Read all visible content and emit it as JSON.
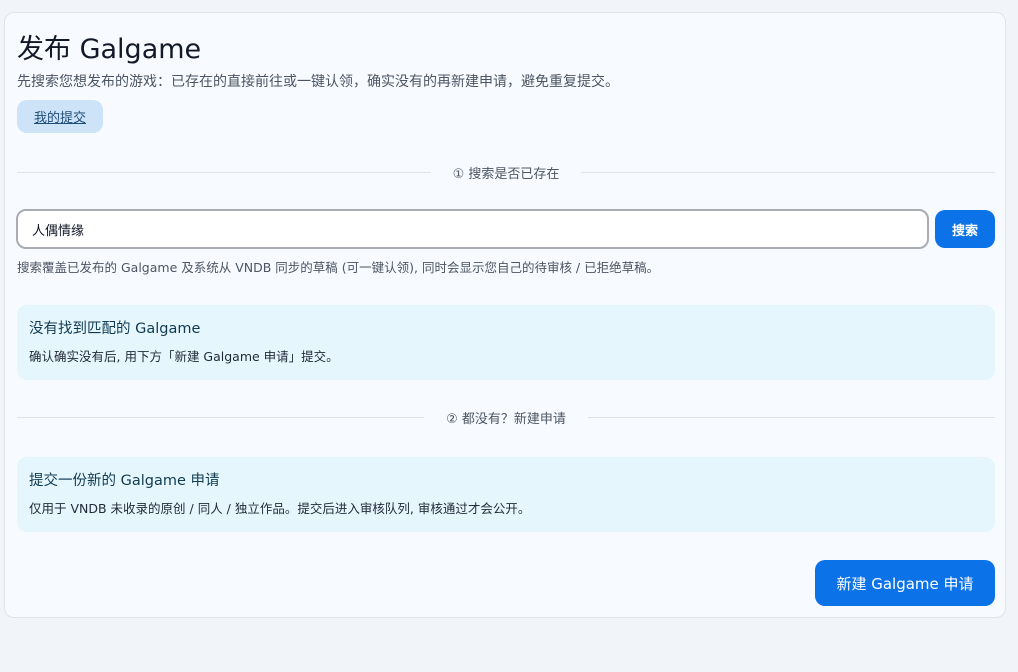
{
  "page": {
    "title": "发布 Galgame",
    "subtitle": "先搜索您想发布的游戏：已存在的直接前往或一键认领，确实没有的再新建申请，避免重复提交。",
    "my_submissions_label": "我的提交"
  },
  "step1": {
    "label": "① 搜索是否已存在"
  },
  "search": {
    "value": "人偶情缘",
    "button_label": "搜索",
    "hint": "搜索覆盖已发布的 Galgame 及系统从 VNDB 同步的草稿 (可一键认领), 同时会显示您自己的待审核 / 已拒绝草稿。"
  },
  "no_match": {
    "title": "没有找到匹配的 Galgame",
    "body": "确认确实没有后, 用下方「新建 Galgame 申请」提交。"
  },
  "step2": {
    "label": "② 都没有？新建申请"
  },
  "new_request": {
    "title": "提交一份新的 Galgame 申请",
    "body": "仅用于 VNDB 未收录的原创 / 同人 / 独立作品。提交后进入审核队列, 审核通过才会公开。",
    "button_label": "新建 Galgame 申请"
  },
  "colors": {
    "accent": "#0b72e7",
    "notice_bg": "#e6f6fd",
    "chip_bg": "#cde3f7"
  }
}
